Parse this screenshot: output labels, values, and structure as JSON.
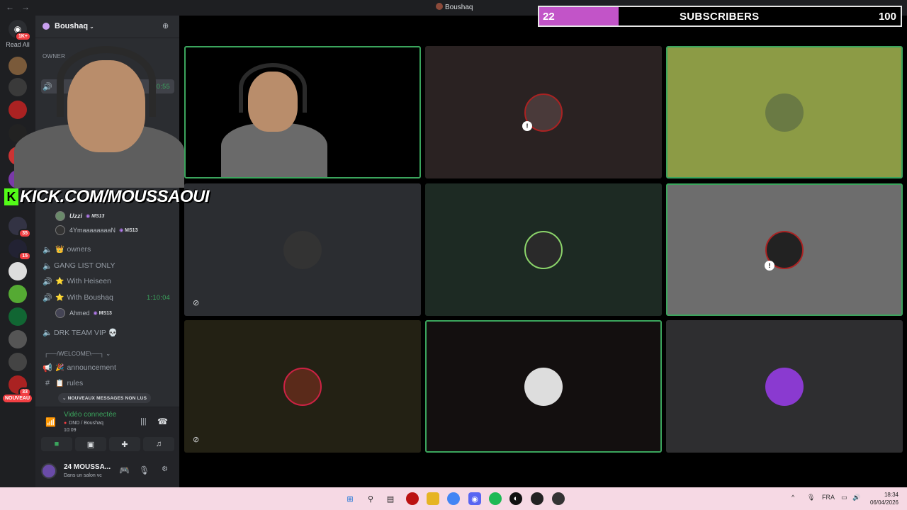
{
  "window": {
    "title": "Boushaq"
  },
  "guilds": {
    "home_badge": "1K+",
    "read_all": "Read All",
    "badges": [
      "35",
      "15",
      "33"
    ],
    "nouveau": "NOUVEAU"
  },
  "server": {
    "name": "Boushaq",
    "category_owner": "OWNER"
  },
  "channels": [
    {
      "icon": "speaker",
      "emoji": "crown",
      "label": "owners",
      "time": ""
    },
    {
      "icon": "speaker",
      "emoji": "",
      "label": "GANG LIST ONLY",
      "time": ""
    },
    {
      "icon": "speaker-active",
      "emoji": "star",
      "label": "With Heiseen",
      "time": ""
    },
    {
      "icon": "speaker-active",
      "emoji": "star",
      "label": "With Boushaq",
      "time": "1:10:04"
    },
    {
      "icon": "speaker",
      "emoji": "",
      "label": "DRK TEAM VIP 💀",
      "time": ""
    },
    {
      "icon": "megaphone",
      "emoji": "",
      "label": "announcement",
      "time": ""
    },
    {
      "icon": "hash",
      "emoji": "",
      "label": "rules",
      "time": ""
    }
  ],
  "top_channel_time": "0:55",
  "voice_users": [
    {
      "name": "Uzzi",
      "tag": "MS13"
    },
    {
      "name": "4YmaaaaaaaaN",
      "tag": "MS13"
    },
    {
      "name": "Ahmed",
      "tag": "MS13"
    }
  ],
  "welcome_category": "┌──/WELCOME\\──┐",
  "new_messages_pill": "NOUVEAUX MESSAGES NON LUS",
  "voice_panel": {
    "status": "Vidéo connectée",
    "sub": "DND / Boushaq",
    "time": "10:09"
  },
  "user_panel": {
    "name": "24 MOUSSA...",
    "status": "Dans un salon vc"
  },
  "subscribers": {
    "current": "22",
    "label": "SUBSCRIBERS",
    "goal": "100",
    "progress": 0.22
  },
  "overlay": {
    "kick_url": "KICK.COM/MOUSSAOUI"
  },
  "colors": {
    "accent_green": "#3ba55d",
    "sub_fill": "#c254c8",
    "kick_green": "#53fc18"
  },
  "taskbar": {
    "lang": "FRA",
    "time": "18:34",
    "date": "06/04/2026"
  }
}
